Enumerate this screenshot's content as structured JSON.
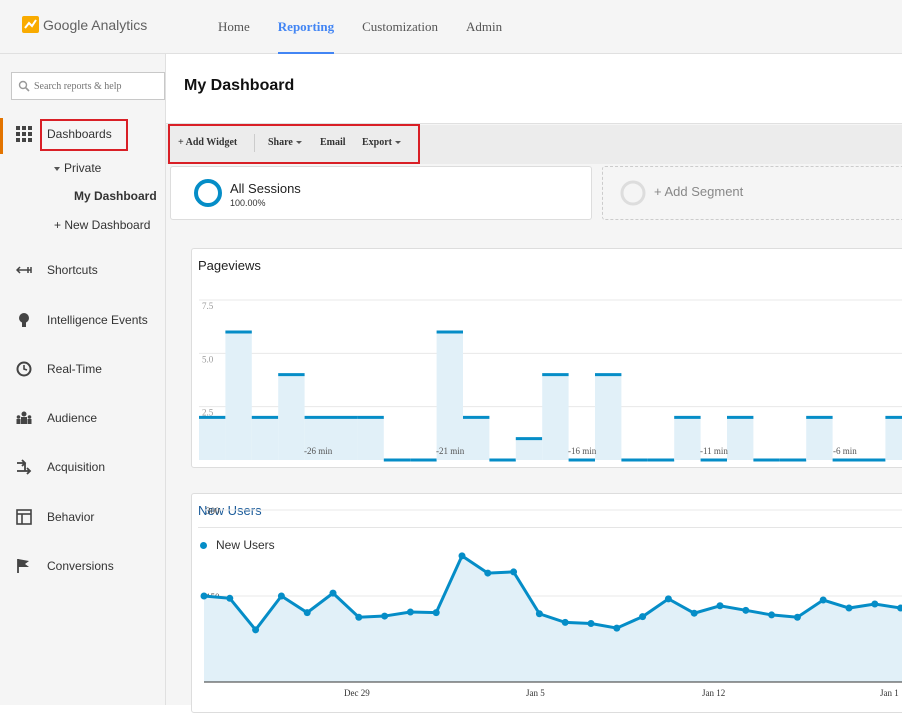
{
  "app": {
    "name": "Google Analytics",
    "brand_color": "#f9ab00",
    "accent_color": "#4285f4",
    "highlight_color": "#d91f26"
  },
  "top_nav": {
    "items": [
      {
        "label": "Home",
        "active": false
      },
      {
        "label": "Reporting",
        "active": true
      },
      {
        "label": "Customization",
        "active": false
      },
      {
        "label": "Admin",
        "active": false
      }
    ]
  },
  "sidebar": {
    "search_placeholder": "Search reports & help",
    "dashboards_label": "Dashboards",
    "private_label": "Private",
    "my_dashboard_label": "My Dashboard",
    "new_dashboard_label": "+ New Dashboard",
    "items": [
      {
        "label": "Shortcuts",
        "icon": "shortcut-arrows-icon"
      },
      {
        "label": "Intelligence Events",
        "icon": "lightbulb-icon"
      },
      {
        "label": "Real-Time",
        "icon": "clock-icon"
      },
      {
        "label": "Audience",
        "icon": "people-icon"
      },
      {
        "label": "Acquisition",
        "icon": "acquisition-arrows-icon"
      },
      {
        "label": "Behavior",
        "icon": "layout-icon"
      },
      {
        "label": "Conversions",
        "icon": "flag-icon"
      }
    ]
  },
  "main": {
    "title": "My Dashboard",
    "toolbar": {
      "add_widget": "+ Add Widget",
      "share": "Share",
      "email": "Email",
      "export": "Export"
    },
    "segments": {
      "active_name": "All Sessions",
      "active_pct": "100.00%",
      "add_label": "+ Add Segment"
    }
  },
  "chart_data": [
    {
      "type": "bar",
      "title": "Pageviews",
      "y_ticks": [
        "7.5",
        "5.0",
        "2.5"
      ],
      "ylim": [
        0,
        7.5
      ],
      "x_tick_labels": [
        "-26 min",
        "-21 min",
        "-16 min",
        "-11 min",
        "-6 min"
      ],
      "values": [
        2,
        6,
        2,
        4,
        2,
        2,
        2,
        0,
        0,
        6,
        2,
        0,
        1,
        4,
        0,
        4,
        0,
        0,
        2,
        0,
        2,
        0,
        0,
        2,
        0,
        0,
        2,
        3
      ],
      "color": "#058dc7",
      "fill": "#e1f0f8",
      "grid": true
    },
    {
      "type": "area",
      "title": "New Users",
      "series": [
        {
          "name": "New Users",
          "values": [
            150,
            146,
            91,
            150,
            121,
            155,
            113,
            115,
            122,
            121,
            220,
            190,
            192,
            119,
            104,
            102,
            94,
            114,
            145,
            120,
            133,
            125,
            117,
            113,
            143,
            129,
            136,
            129,
            136
          ]
        }
      ],
      "y_ticks": [
        "300",
        "150"
      ],
      "ylim": [
        0,
        300
      ],
      "x_tick_labels": [
        "Dec 29",
        "Jan 5",
        "Jan 12",
        "Jan 1"
      ],
      "color": "#058dc7",
      "fill": "#e1f0f8",
      "legend": "top-left",
      "grid": true
    }
  ]
}
